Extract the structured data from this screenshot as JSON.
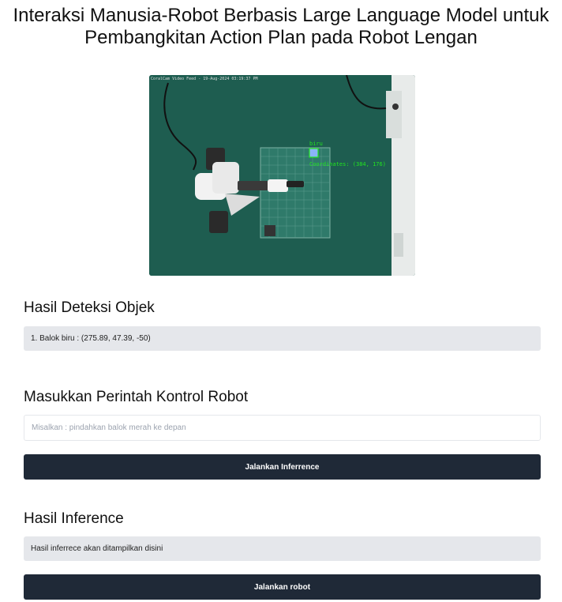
{
  "header": {
    "title_line1": "Interaksi Manusia-Robot Berbasis Large Language Model untuk",
    "title_line2": "Pembangkitan Action Plan pada Robot Lengan"
  },
  "video_feed": {
    "overlay_header": "CoralCam Video Feed - 19-Aug-2024 03:19:37 PM",
    "detection_label": "biru",
    "detection_coordinates": "Coordinates: (384, 176)"
  },
  "detection": {
    "heading": "Hasil Deteksi Objek",
    "result": "1. Balok biru : (275.89, 47.39, -50)"
  },
  "command": {
    "heading": "Masukkan Perintah Kontrol Robot",
    "placeholder": "Misalkan : pindahkan balok merah ke depan",
    "value": "",
    "button_label": "Jalankan Inferrence"
  },
  "inference": {
    "heading": "Hasil Inference",
    "result": "Hasil inferrece akan ditampilkan disini",
    "button_label": "Jalankan robot"
  },
  "colors": {
    "button_bg": "#1f2937",
    "readonly_bg": "#e5e7eb",
    "detection_green": "#22e51f",
    "table_green": "#1f5b4e"
  }
}
